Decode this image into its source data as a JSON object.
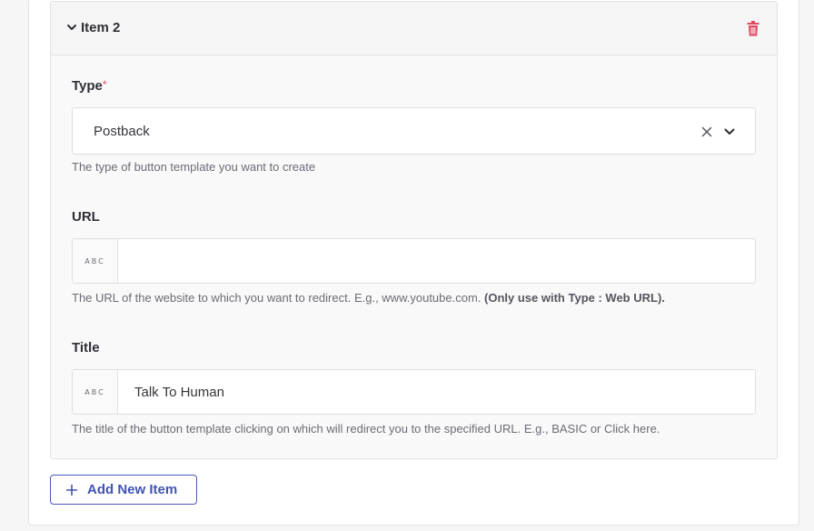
{
  "item": {
    "title": "Item 2"
  },
  "fields": {
    "type": {
      "label": "Type",
      "required_mark": "*",
      "value": "Postback",
      "help": "The type of button template you want to create"
    },
    "url": {
      "label": "URL",
      "prefix": "ABC",
      "value": "",
      "placeholder": "",
      "help_text": "The URL of the website to which you want to redirect. E.g., www.youtube.com.",
      "help_bold": "(Only use with Type : Web URL)."
    },
    "title": {
      "label": "Title",
      "prefix": "ABC",
      "value": "Talk To Human",
      "help": "The title of the button template clicking on which will redirect you to the specified URL. E.g., BASIC or Click here."
    }
  },
  "actions": {
    "add_item_label": "Add New Item"
  },
  "icons": {
    "collapse": "chevron-down-icon",
    "delete": "trash-icon",
    "clear": "close-icon",
    "dropdown": "chevron-down-icon",
    "add": "plus-icon"
  },
  "colors": {
    "accent": "#4053b5",
    "danger": "#e0495f"
  }
}
